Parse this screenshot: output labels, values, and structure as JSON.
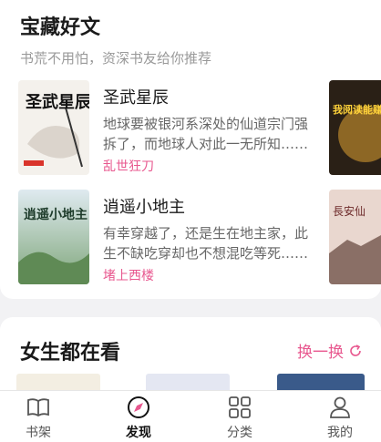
{
  "section1": {
    "title": "宝藏好文",
    "subtitle": "书荒不用怕，资深书友给你推荐",
    "books": [
      {
        "title": "圣武星辰",
        "desc": "地球要被银河系深处的仙道宗门强拆了，而地球人对此一无所知……",
        "author": "乱世狂刀",
        "cover_text": "圣武星辰"
      },
      {
        "title": "逍遥小地主",
        "desc": "有幸穿越了，还是生在地主家，此生不缺吃穿却也不想混吃等死……",
        "author": "堵上西楼",
        "cover_text": "逍遥小地主"
      }
    ],
    "peek_covers": [
      {
        "cover_text": "我阅读能赚钱"
      },
      {
        "cover_text": "長安仙"
      }
    ]
  },
  "section2": {
    "title": "女生都在看",
    "refresh_label": "换一换"
  },
  "tabbar": {
    "tabs": [
      {
        "label": "书架",
        "icon": "book-icon"
      },
      {
        "label": "发现",
        "icon": "compass-icon"
      },
      {
        "label": "分类",
        "icon": "grid-icon"
      },
      {
        "label": "我的",
        "icon": "user-icon"
      }
    ]
  },
  "colors": {
    "accent": "#e8588f",
    "text": "#1a1a1a",
    "muted": "#999999"
  }
}
